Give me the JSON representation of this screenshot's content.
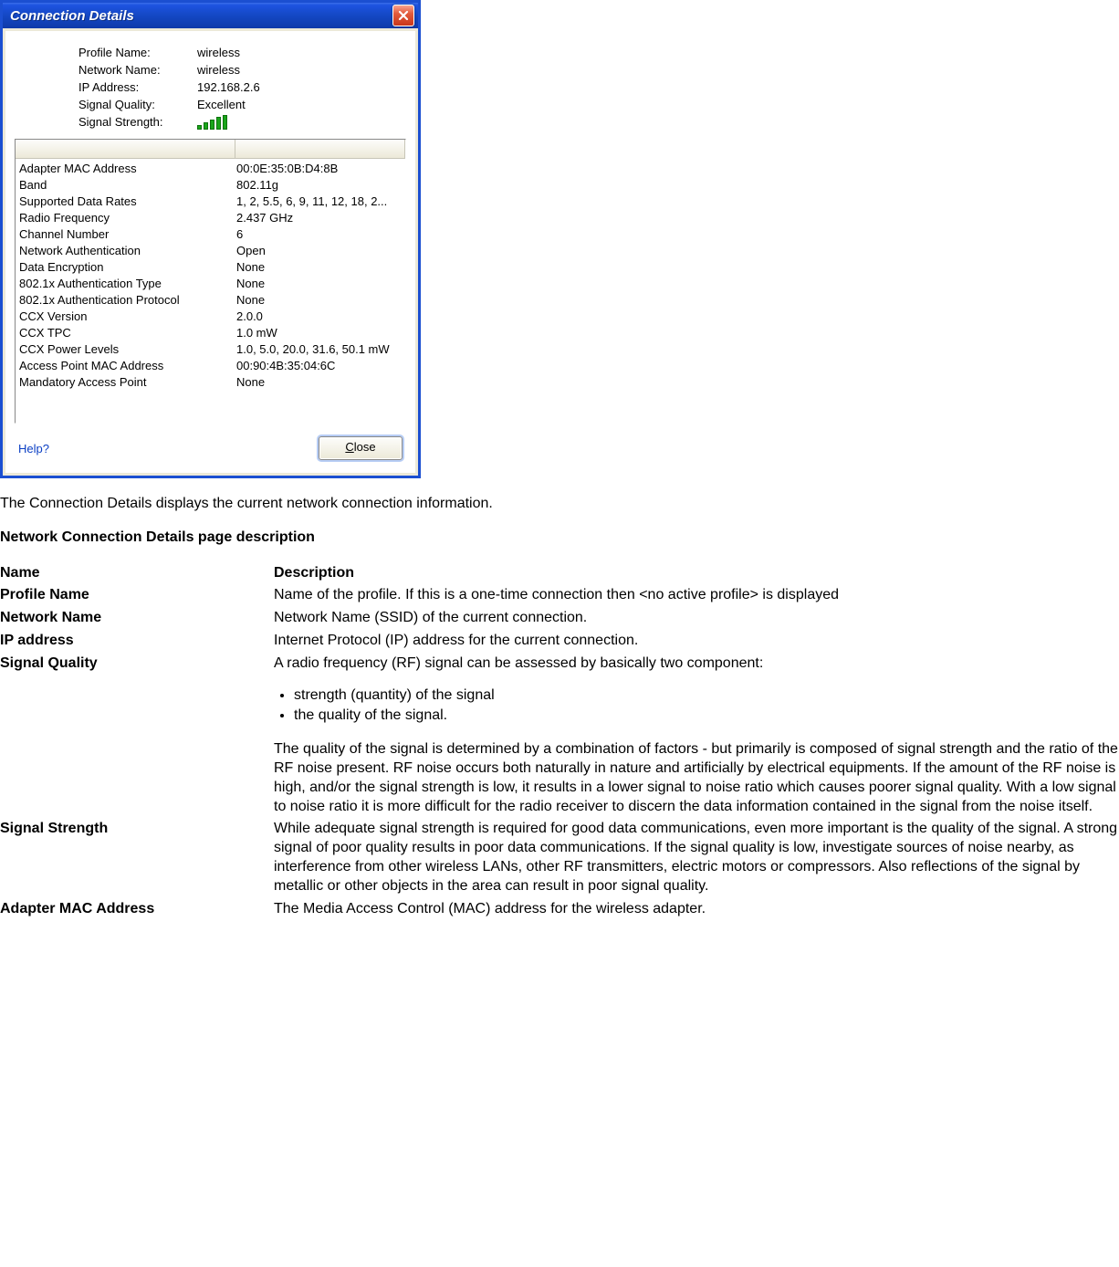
{
  "dialog": {
    "title": "Connection Details",
    "summary": {
      "rows": [
        {
          "label": "Profile Name:",
          "value": "wireless"
        },
        {
          "label": "Network Name:",
          "value": "wireless"
        },
        {
          "label": "IP Address:",
          "value": "192.168.2.6"
        },
        {
          "label": "Signal Quality:",
          "value": "Excellent"
        },
        {
          "label": "Signal Strength:",
          "value": ""
        }
      ]
    },
    "details": [
      {
        "label": "Adapter MAC Address",
        "value": "00:0E:35:0B:D4:8B"
      },
      {
        "label": "Band",
        "value": "802.11g"
      },
      {
        "label": "Supported Data Rates",
        "value": "1, 2, 5.5, 6, 9, 11, 12, 18, 2..."
      },
      {
        "label": "Radio Frequency",
        "value": "2.437 GHz"
      },
      {
        "label": "Channel Number",
        "value": "6"
      },
      {
        "label": "Network Authentication",
        "value": "Open"
      },
      {
        "label": "Data Encryption",
        "value": "None"
      },
      {
        "label": "802.1x Authentication Type",
        "value": "None"
      },
      {
        "label": "802.1x Authentication Protocol",
        "value": "None"
      },
      {
        "label": "CCX Version",
        "value": "2.0.0"
      },
      {
        "label": "CCX TPC",
        "value": "1.0 mW"
      },
      {
        "label": "CCX Power Levels",
        "value": "1.0, 5.0, 20.0, 31.6, 50.1 mW"
      },
      {
        "label": "Access Point MAC Address",
        "value": "00:90:4B:35:04:6C"
      },
      {
        "label": "Mandatory Access Point",
        "value": "None"
      }
    ],
    "help": "Help?",
    "close": "Close"
  },
  "doc": {
    "intro": "The Connection Details displays the current network connection information.",
    "heading": "Network Connection Details page description",
    "table": {
      "header_name": "Name",
      "header_desc": "Description",
      "rows": {
        "profile_name": {
          "name": "Profile Name",
          "desc": "Name of the profile. If this is a one-time connection then <no active profile> is displayed"
        },
        "network_name": {
          "name": "Network Name",
          "desc": "Network Name (SSID) of the current connection."
        },
        "ip_address": {
          "name": "IP address",
          "desc": "Internet Protocol (IP) address for the current connection."
        },
        "signal_quality": {
          "name": "Signal Quality",
          "desc_intro": "A radio frequency (RF) signal can be assessed by basically two component:",
          "bullets": [
            "strength (quantity) of the signal",
            "the quality of the signal."
          ],
          "desc_body": "The quality of the signal is determined by a combination of factors - but primarily is composed of signal strength and the ratio of the RF noise present.  RF noise occurs both naturally in nature and artificially by electrical equipments.  If the amount of the RF noise is high, and/or the signal strength is low, it results in a lower signal to noise ratio which causes poorer signal quality.  With a low signal to noise ratio it is more difficult for the radio receiver to discern the data information contained in the signal from the noise itself."
        },
        "signal_strength": {
          "name": "Signal Strength",
          "desc": "While adequate signal strength is required for good data communications, even more important is the quality of the signal.  A strong signal of poor quality results in poor data communications.  If the signal quality is low, investigate sources of noise nearby, as interference from other wireless LANs, other RF transmitters, electric motors or compressors.  Also reflections of the signal by metallic or other objects in the area can result in poor signal quality."
        },
        "adapter_mac": {
          "name": "Adapter MAC Address",
          "desc": "The Media Access Control (MAC) address for the wireless adapter."
        }
      }
    }
  }
}
